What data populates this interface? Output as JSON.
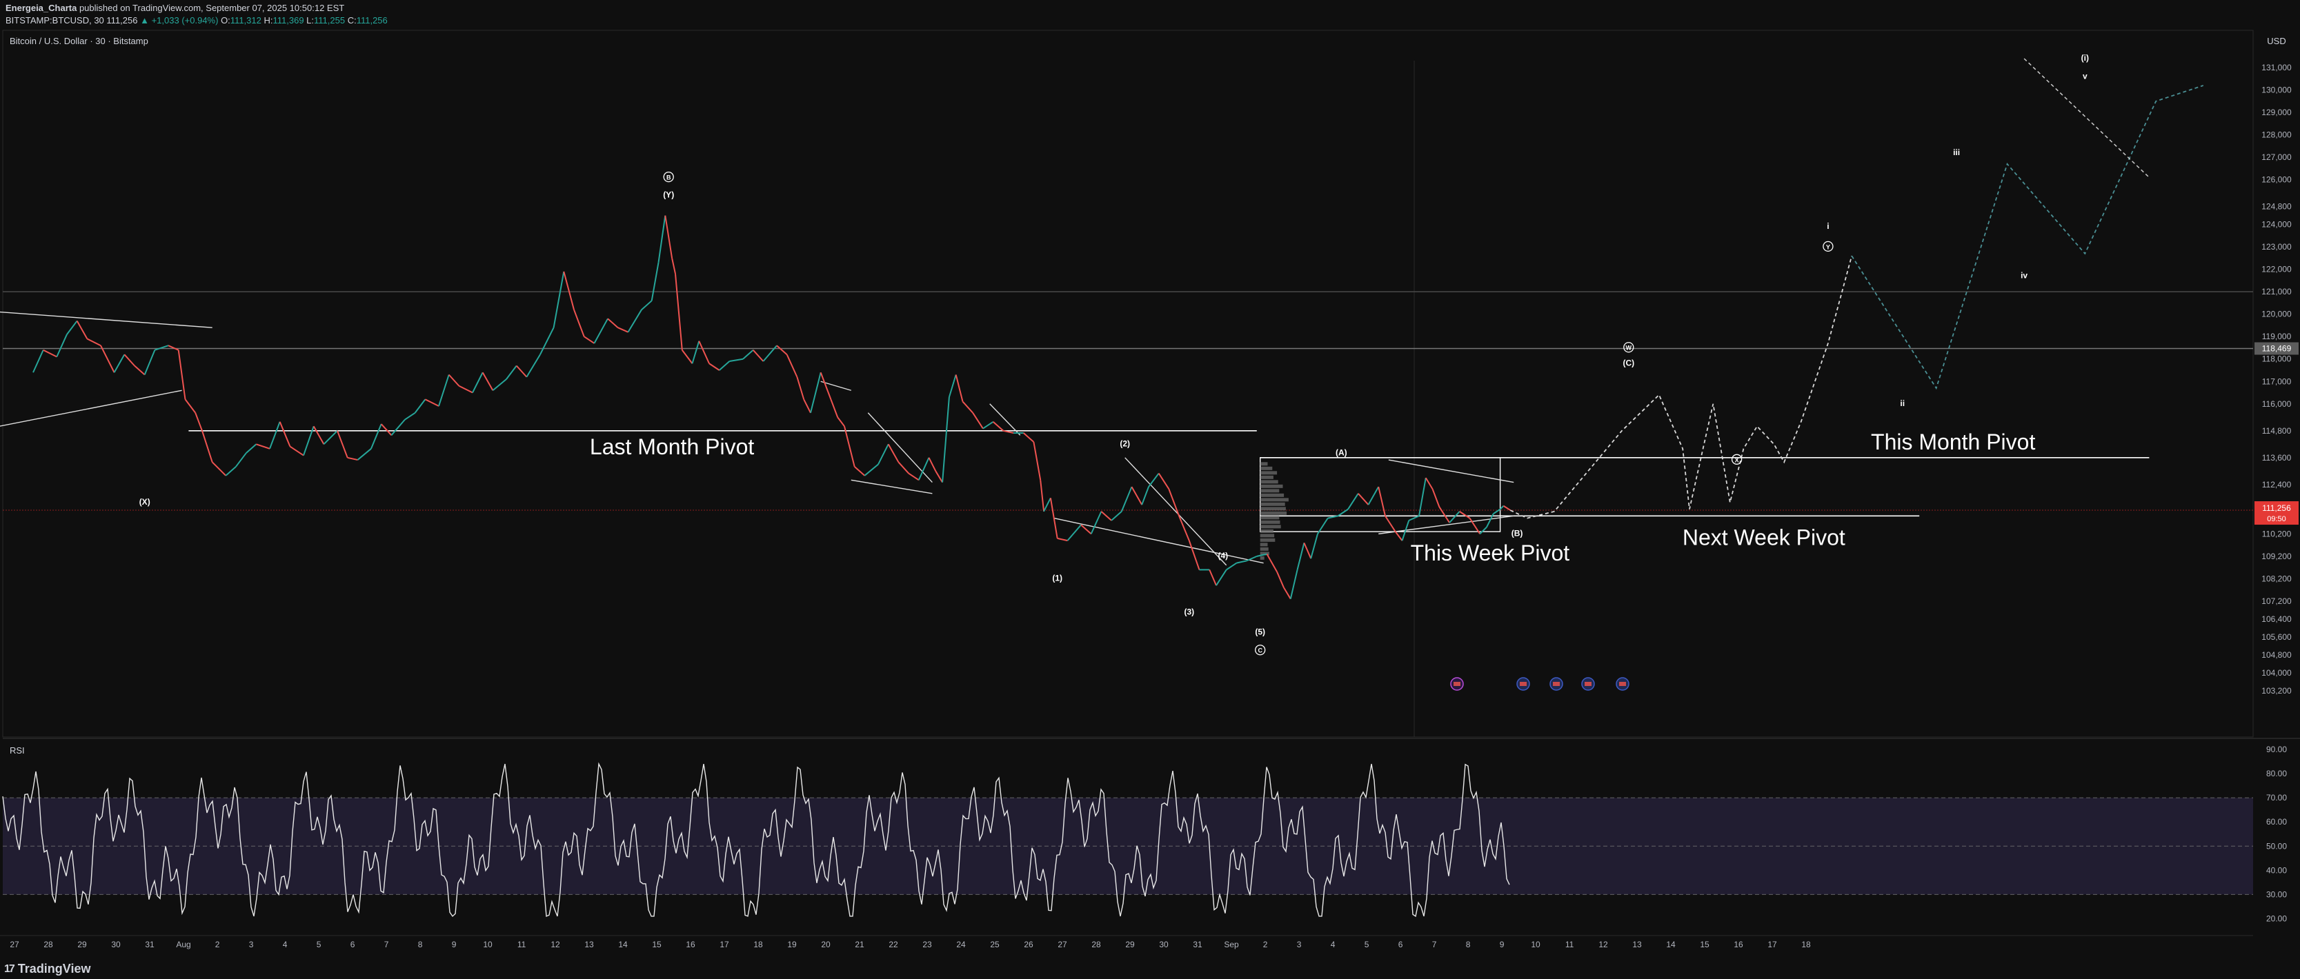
{
  "header": {
    "author": "Energeia_Charta",
    "published": "published on TradingView.com, September 07, 2025 10:50:12 EST",
    "symbol": "BITSTAMP:BTCUSD, 30",
    "last": "111,256",
    "change": "▲ +1,033 (+0.94%)",
    "o_label": "O:",
    "o": "111,312",
    "h_label": "H:",
    "h": "111,369",
    "l_label": "L:",
    "l": "111,255",
    "c_label": "C:",
    "c": "111,256"
  },
  "footer": {
    "brand": "TradingView"
  },
  "colors": {
    "up": "#26a69a",
    "down": "#ef5350",
    "bg": "#0f0f0f",
    "text": "#d1d4dc",
    "pivot": "#ffffff",
    "rsi_band": "#2a2340",
    "projection": "#4a8f94"
  },
  "chart_data": {
    "type": "line",
    "title": "Bitcoin / U.S. Dollar · 30 · Bitstamp",
    "currency": "USD",
    "ylim": [
      102800,
      131800
    ],
    "y_ticks": [
      "131,000",
      "130,000",
      "129,000",
      "128,000",
      "127,000",
      "126,000",
      "124,800",
      "124,000",
      "123,000",
      "122,000",
      "121,000",
      "120,000",
      "119,000",
      "118,000",
      "117,000",
      "116,000",
      "114,800",
      "113,600",
      "112,400",
      "111,200",
      "110,200",
      "109,200",
      "108,200",
      "107,200",
      "106,400",
      "105,600",
      "104,800",
      "104,000",
      "103,200"
    ],
    "y_tick_values": [
      131000,
      130000,
      129000,
      128000,
      127000,
      126000,
      124800,
      124000,
      123000,
      122000,
      121000,
      120000,
      119000,
      118000,
      117000,
      116000,
      114800,
      113600,
      112400,
      111200,
      110200,
      109200,
      108200,
      107200,
      106400,
      105600,
      104800,
      104000,
      103200
    ],
    "x_ticks": [
      "27",
      "28",
      "29",
      "30",
      "31",
      "Aug",
      "2",
      "3",
      "4",
      "5",
      "6",
      "7",
      "8",
      "9",
      "10",
      "11",
      "12",
      "13",
      "14",
      "15",
      "16",
      "17",
      "18",
      "19",
      "20",
      "21",
      "22",
      "23",
      "24",
      "25",
      "26",
      "27",
      "28",
      "29",
      "30",
      "31",
      "Sep",
      "2",
      "3",
      "4",
      "5",
      "6",
      "7",
      "8",
      "9",
      "10",
      "11",
      "12",
      "13",
      "14",
      "15",
      "16",
      "17",
      "18"
    ],
    "price_label": "111,256",
    "price_timer": "09:50",
    "marked_level": "118,469",
    "price_path": [
      [
        0,
        117400
      ],
      [
        0.3,
        118400
      ],
      [
        0.7,
        118100
      ],
      [
        1,
        119100
      ],
      [
        1.3,
        119700
      ],
      [
        1.6,
        118900
      ],
      [
        2,
        118600
      ],
      [
        2.4,
        117400
      ],
      [
        2.7,
        118200
      ],
      [
        3,
        117700
      ],
      [
        3.3,
        117300
      ],
      [
        3.6,
        118400
      ],
      [
        4,
        118600
      ],
      [
        4.3,
        118400
      ],
      [
        4.5,
        116200
      ],
      [
        4.8,
        115600
      ],
      [
        5,
        114800
      ],
      [
        5.3,
        113400
      ],
      [
        5.7,
        112800
      ],
      [
        6,
        113200
      ],
      [
        6.3,
        113800
      ],
      [
        6.6,
        114200
      ],
      [
        7,
        114000
      ],
      [
        7.3,
        115200
      ],
      [
        7.6,
        114100
      ],
      [
        8,
        113700
      ],
      [
        8.3,
        115000
      ],
      [
        8.6,
        114200
      ],
      [
        9,
        114800
      ],
      [
        9.3,
        113600
      ],
      [
        9.6,
        113500
      ],
      [
        10,
        114000
      ],
      [
        10.3,
        115100
      ],
      [
        10.6,
        114600
      ],
      [
        11,
        115300
      ],
      [
        11.3,
        115600
      ],
      [
        11.6,
        116200
      ],
      [
        12,
        115900
      ],
      [
        12.3,
        117300
      ],
      [
        12.6,
        116800
      ],
      [
        13,
        116500
      ],
      [
        13.3,
        117400
      ],
      [
        13.6,
        116600
      ],
      [
        14,
        117100
      ],
      [
        14.3,
        117700
      ],
      [
        14.6,
        117200
      ],
      [
        15,
        118200
      ],
      [
        15.4,
        119400
      ],
      [
        15.7,
        121900
      ],
      [
        16,
        120200
      ],
      [
        16.3,
        119000
      ],
      [
        16.6,
        118700
      ],
      [
        17,
        119800
      ],
      [
        17.3,
        119400
      ],
      [
        17.6,
        119200
      ],
      [
        18,
        120200
      ],
      [
        18.3,
        120600
      ],
      [
        18.5,
        122300
      ],
      [
        18.7,
        124400
      ],
      [
        18.9,
        122500
      ],
      [
        19,
        121800
      ],
      [
        19.2,
        118400
      ],
      [
        19.5,
        117800
      ],
      [
        19.7,
        118800
      ],
      [
        20,
        117800
      ],
      [
        20.3,
        117500
      ],
      [
        20.6,
        117900
      ],
      [
        21,
        118000
      ],
      [
        21.3,
        118400
      ],
      [
        21.6,
        117900
      ],
      [
        22,
        118600
      ],
      [
        22.3,
        118200
      ],
      [
        22.6,
        117200
      ],
      [
        22.8,
        116200
      ],
      [
        23,
        115600
      ],
      [
        23.3,
        117400
      ],
      [
        23.6,
        116200
      ],
      [
        23.8,
        115400
      ],
      [
        24,
        115000
      ],
      [
        24.3,
        113200
      ],
      [
        24.6,
        112800
      ],
      [
        25,
        113300
      ],
      [
        25.3,
        114200
      ],
      [
        25.6,
        113400
      ],
      [
        25.9,
        112900
      ],
      [
        26.2,
        112600
      ],
      [
        26.5,
        113600
      ],
      [
        26.7,
        113000
      ],
      [
        26.9,
        112500
      ],
      [
        27.1,
        116300
      ],
      [
        27.3,
        117300
      ],
      [
        27.5,
        116100
      ],
      [
        27.8,
        115600
      ],
      [
        28.1,
        114900
      ],
      [
        28.4,
        115200
      ],
      [
        28.7,
        114800
      ],
      [
        29,
        114700
      ],
      [
        29.3,
        114700
      ],
      [
        29.6,
        114300
      ],
      [
        29.8,
        112600
      ],
      [
        29.9,
        111200
      ],
      [
        30.1,
        111800
      ],
      [
        30.3,
        110000
      ],
      [
        30.6,
        109900
      ],
      [
        31,
        110600
      ],
      [
        31.3,
        110200
      ],
      [
        31.6,
        111200
      ],
      [
        31.9,
        110800
      ],
      [
        32.2,
        111200
      ],
      [
        32.5,
        112300
      ],
      [
        32.8,
        111500
      ],
      [
        33,
        112300
      ],
      [
        33.3,
        112900
      ],
      [
        33.6,
        112200
      ],
      [
        33.9,
        111000
      ],
      [
        34.2,
        109900
      ],
      [
        34.5,
        108600
      ],
      [
        34.8,
        108600
      ],
      [
        35,
        107900
      ],
      [
        35.3,
        108600
      ],
      [
        35.6,
        108900
      ],
      [
        35.9,
        109000
      ],
      [
        36.2,
        109200
      ],
      [
        36.5,
        109300
      ],
      [
        36.8,
        108500
      ],
      [
        37,
        107800
      ],
      [
        37.2,
        107300
      ],
      [
        37.4,
        108600
      ],
      [
        37.6,
        109800
      ],
      [
        37.8,
        109100
      ],
      [
        38,
        110200
      ],
      [
        38.3,
        110900
      ],
      [
        38.6,
        111000
      ],
      [
        38.9,
        111300
      ],
      [
        39.2,
        112000
      ],
      [
        39.5,
        111500
      ],
      [
        39.8,
        112300
      ],
      [
        40,
        111000
      ],
      [
        40.3,
        110300
      ],
      [
        40.5,
        109900
      ],
      [
        40.7,
        110800
      ],
      [
        41,
        111000
      ],
      [
        41.2,
        112700
      ],
      [
        41.4,
        112200
      ],
      [
        41.6,
        111400
      ],
      [
        41.9,
        110700
      ],
      [
        42.2,
        111200
      ],
      [
        42.5,
        110900
      ],
      [
        42.8,
        110200
      ],
      [
        43,
        110500
      ],
      [
        43.2,
        111100
      ],
      [
        43.4,
        111300
      ],
      [
        43.5,
        111450
      ],
      [
        43.7,
        111256
      ]
    ],
    "projection_white": [
      [
        43.7,
        111256
      ],
      [
        44.2,
        110900
      ],
      [
        45,
        111200
      ],
      [
        46,
        113000
      ],
      [
        47,
        114800
      ],
      [
        48.1,
        116400
      ],
      [
        48.8,
        114000
      ],
      [
        49,
        111300
      ],
      [
        49.4,
        114000
      ],
      [
        49.7,
        116000
      ],
      [
        50.2,
        111600
      ],
      [
        50.6,
        114000
      ],
      [
        51,
        115000
      ],
      [
        51.5,
        114200
      ],
      [
        51.8,
        113400
      ],
      [
        52.3,
        115200
      ],
      [
        53.1,
        118700
      ],
      [
        53.8,
        122600
      ]
    ],
    "projection_teal": [
      [
        53.8,
        122600
      ],
      [
        56.3,
        116700
      ],
      [
        58.4,
        126700
      ],
      [
        60.7,
        122700
      ],
      [
        62.8,
        129500
      ],
      [
        64.2,
        130200
      ]
    ],
    "rsi": {
      "label": "RSI",
      "ylim": [
        15,
        92
      ],
      "y_ticks": [
        "90.00",
        "80.00",
        "70.00",
        "60.00",
        "50.00",
        "40.00",
        "30.00",
        "20.00"
      ],
      "y_tick_values": [
        90,
        80,
        70,
        60,
        50,
        40,
        30,
        20
      ],
      "upper_band": 70,
      "lower_band": 30,
      "middle": 50
    },
    "annotations": {
      "pivots": [
        {
          "label": "Last Month Pivot",
          "value": 114800
        },
        {
          "label": "This Month Pivot",
          "value": 113600
        },
        {
          "label": "Next Week Pivot",
          "value": 111000
        },
        {
          "label": "This Week Pivot",
          "value": 110300
        }
      ],
      "waves": [
        "B",
        "(Y)",
        "(X)",
        "(1)",
        "(2)",
        "(3)",
        "(4)",
        "(5)",
        "C",
        "(A)",
        "(B)",
        "W",
        "(C)",
        "X",
        "i",
        "Y",
        "ii",
        "iii",
        "iv",
        "v",
        "(i)"
      ]
    }
  }
}
